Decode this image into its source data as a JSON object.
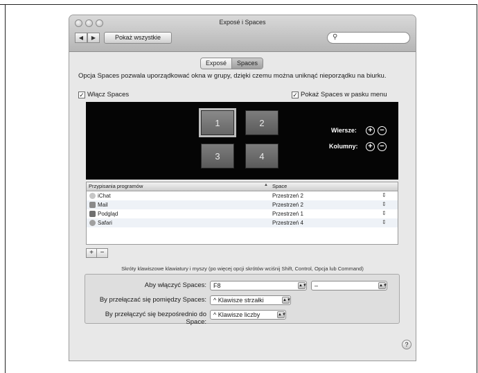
{
  "window": {
    "title": "Exposé i Spaces"
  },
  "toolbar": {
    "back": "◀",
    "forward": "▶",
    "show_all": "Pokaż wszystkie",
    "search_placeholder": ""
  },
  "tabs": [
    {
      "label": "Exposé"
    },
    {
      "label": "Spaces"
    }
  ],
  "description": "Opcja Spaces pozwala uporządkować okna w grupy, dzięki czemu można uniknąć nieporządku na biurku.",
  "checkboxes": {
    "enable_spaces": "Włącz Spaces",
    "show_in_menu": "Pokaż Spaces w pasku menu"
  },
  "spaces_grid": {
    "spaces": [
      "1",
      "2",
      "3",
      "4"
    ],
    "rows_label": "Wiersze:",
    "columns_label": "Kolumny:"
  },
  "table": {
    "headers": {
      "app": "Przypisania programów",
      "space": "Space"
    },
    "rows": [
      {
        "app": "iChat",
        "space": "Przestrzeń 2"
      },
      {
        "app": "Mail",
        "space": "Przestrzeń 2"
      },
      {
        "app": "Podgląd",
        "space": "Przestrzeń 1"
      },
      {
        "app": "Safari",
        "space": "Przestrzeń 4"
      }
    ]
  },
  "buttons": {
    "add": "+",
    "remove": "−"
  },
  "shortcuts": {
    "title": "Skróty klawiszowe klawiatury i myszy (po więcej opcji skrótów wciśnij Shift, Control, Opcja lub Command)",
    "activate": {
      "label": "Aby włączyć Spaces:",
      "value": "F8",
      "mouse_value": "–"
    },
    "switch_between": {
      "label": "By przełączać się pomiędzy Spaces:",
      "value": "^ Klawisze strzałki"
    },
    "switch_direct": {
      "label": "By przełączyć się bezpośrednio do Space:",
      "value": "^ Klawisze liczby"
    }
  },
  "help": "?"
}
